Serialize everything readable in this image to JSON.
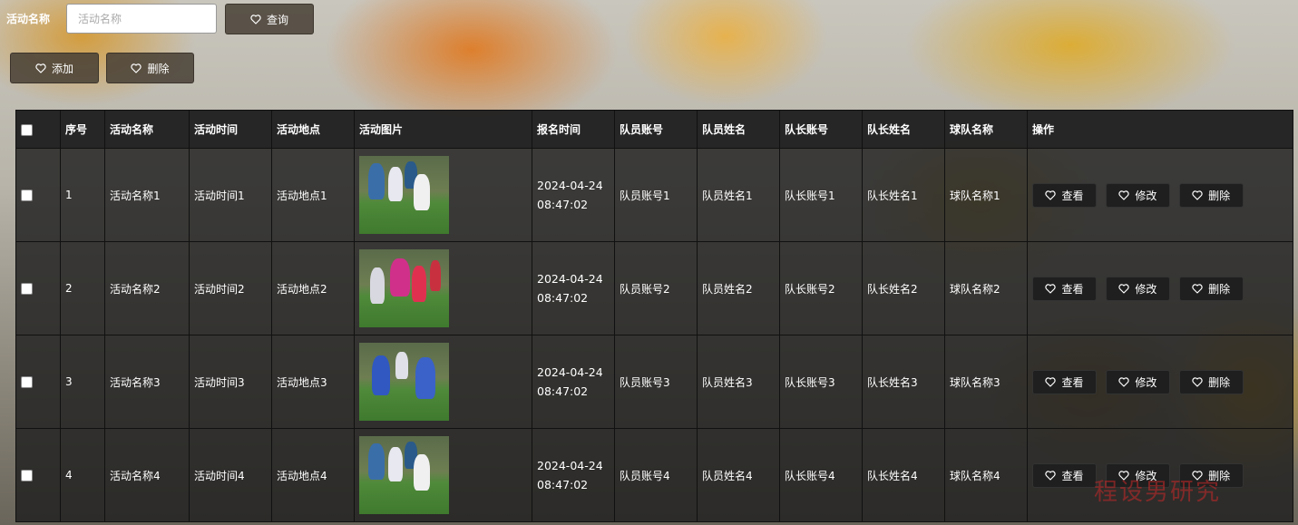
{
  "search": {
    "label": "活动名称",
    "placeholder": "活动名称",
    "value": "",
    "button_label": "查询"
  },
  "actions": {
    "add_label": "添加",
    "delete_label": "删除"
  },
  "table": {
    "columns": [
      "序号",
      "活动名称",
      "活动时间",
      "活动地点",
      "活动图片",
      "报名时间",
      "队员账号",
      "队员姓名",
      "队长账号",
      "队长姓名",
      "球队名称",
      "操作"
    ],
    "rows": [
      {
        "index": "1",
        "name": "活动名称1",
        "time": "活动时间1",
        "place": "活动地点1",
        "signup_date": "2024-04-24",
        "signup_time": "08:47:02",
        "member_account": "队员账号1",
        "member_name": "队员姓名1",
        "captain_account": "队长账号1",
        "captain_name": "队长姓名1",
        "team_name": "球队名称1",
        "image": "soccer-photo-a"
      },
      {
        "index": "2",
        "name": "活动名称2",
        "time": "活动时间2",
        "place": "活动地点2",
        "signup_date": "2024-04-24",
        "signup_time": "08:47:02",
        "member_account": "队员账号2",
        "member_name": "队员姓名2",
        "captain_account": "队长账号2",
        "captain_name": "队长姓名2",
        "team_name": "球队名称2",
        "image": "soccer-photo-b"
      },
      {
        "index": "3",
        "name": "活动名称3",
        "time": "活动时间3",
        "place": "活动地点3",
        "signup_date": "2024-04-24",
        "signup_time": "08:47:02",
        "member_account": "队员账号3",
        "member_name": "队员姓名3",
        "captain_account": "队长账号3",
        "captain_name": "队长姓名3",
        "team_name": "球队名称3",
        "image": "soccer-photo-c"
      },
      {
        "index": "4",
        "name": "活动名称4",
        "time": "活动时间4",
        "place": "活动地点4",
        "signup_date": "2024-04-24",
        "signup_time": "08:47:02",
        "member_account": "队员账号4",
        "member_name": "队员姓名4",
        "captain_account": "队长账号4",
        "captain_name": "队长姓名4",
        "team_name": "球队名称4",
        "image": "soccer-photo-a"
      }
    ],
    "row_actions": {
      "view_label": "查看",
      "edit_label": "修改",
      "delete_label": "删除"
    }
  },
  "icons": {
    "button_icon": "heart-icon"
  },
  "watermark": "程设男研究",
  "colors": {
    "table_bg": "#1e1e1e",
    "button_bg": "#463e34",
    "op_button_bg": "#1f1f1f"
  }
}
